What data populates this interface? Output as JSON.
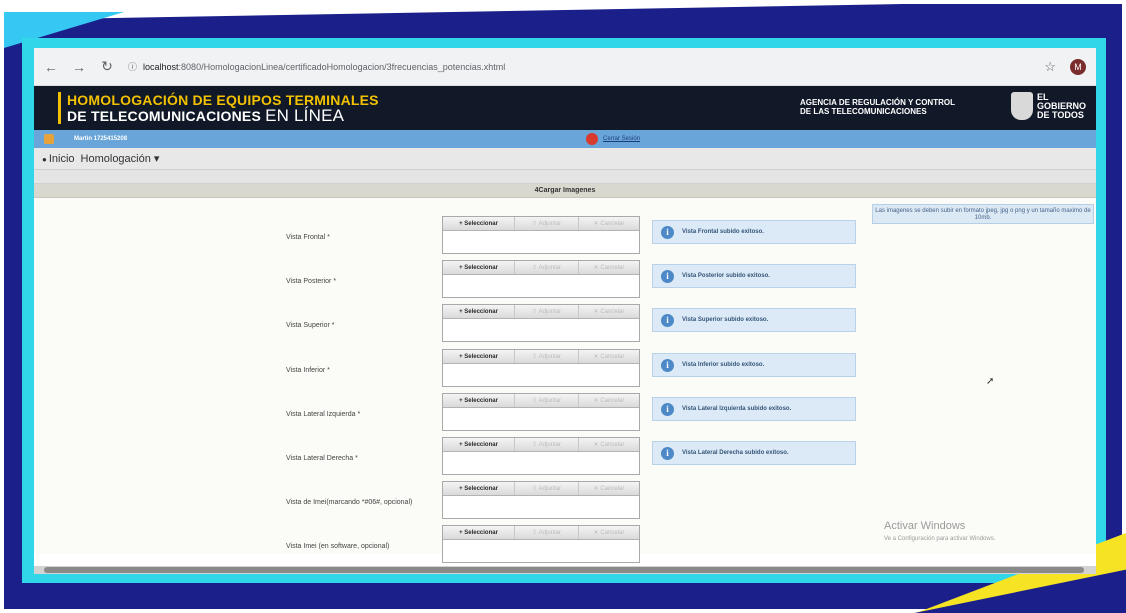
{
  "colors": {
    "frame_blue": "#1b1f8a",
    "frame_cyan": "#31d6e8",
    "frame_yellow": "#f6e324",
    "header_dark": "#111827",
    "header_gold": "#f2c200"
  },
  "browser": {
    "url_host": "localhost",
    "url_path": ":8080/HomologacionLinea/certificadoHomologacion/3frecuencias_potencias.xhtml",
    "profile_initial": "M"
  },
  "header": {
    "title_line1": "HOMOLOGACIÓN DE EQUIPOS TERMINALES",
    "title_line2": "DE TELECOMUNICACIONES",
    "title_line2_suffix": "EN LÍNEA",
    "agency_line1": "AGENCIA DE REGULACIÓN Y CONTROL",
    "agency_line2": "DE LAS TELECOMUNICACIONES",
    "gov_line1": "EL",
    "gov_line2": "GOBIERNO",
    "gov_line3": "DE TODOS"
  },
  "user_strip": {
    "user": "Martin 1725415208",
    "logout": "Cerrar Sesión"
  },
  "menu": {
    "home": "Inicio",
    "homologacion": "Homologación ▾"
  },
  "section": {
    "title": "4Cargar Imagenes"
  },
  "hint": "Las imagenes se deben subir en formato jpeg, jpg o png y un tamaño maximo de 10mb.",
  "uploader": {
    "select": "Seleccionar",
    "upload": "Adjuntar",
    "cancel": "Cancelar"
  },
  "rows": [
    {
      "label": "Vista Frontal *",
      "message": "Vista Frontal subido exitoso."
    },
    {
      "label": "Vista Posterior *",
      "message": "Vista Posterior subido exitoso."
    },
    {
      "label": "Vista Superior *",
      "message": "Vista Superior subido exitoso."
    },
    {
      "label": "Vista Inferior *",
      "message": "Vista Inferior subido exitoso."
    },
    {
      "label": "Vista Lateral Izquierda *",
      "message": "Vista Lateral Izquierda subido exitoso."
    },
    {
      "label": "Vista Lateral Derecha *",
      "message": "Vista Lateral Derecha subido exitoso."
    },
    {
      "label": "Vista de Imei(marcando *#06#, opcional)",
      "message": ""
    },
    {
      "label": "Vista Imei (en software, opcional)",
      "message": ""
    }
  ],
  "watermark": {
    "title": "Activar Windows",
    "subtitle": "Ve a Configuración para activar Windows."
  }
}
